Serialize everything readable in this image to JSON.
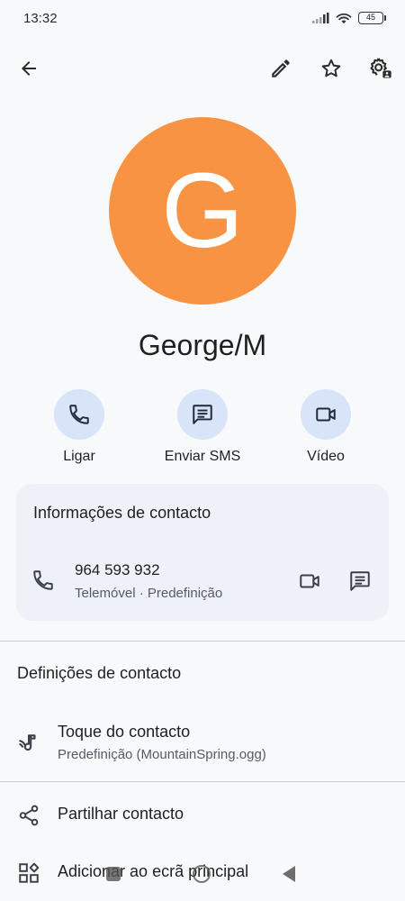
{
  "status_bar": {
    "time": "13:32",
    "battery": "45",
    "icons": [
      "signal-icon",
      "wifi-icon",
      "battery-icon"
    ]
  },
  "top_bar": {
    "icons": [
      "back-arrow-icon",
      "edit-pencil-icon",
      "star-outline-icon",
      "settings-gear-icon"
    ]
  },
  "contact": {
    "avatar_letter": "G",
    "avatar_color": "#f89343",
    "name": "George/M"
  },
  "actions": [
    {
      "label": "Ligar",
      "icon": "phone-icon"
    },
    {
      "label": "Enviar SMS",
      "icon": "message-icon"
    },
    {
      "label": "Vídeo",
      "icon": "video-camera-icon"
    }
  ],
  "info_card": {
    "title": "Informações de contacto",
    "phone_number": "964 593 932",
    "phone_sub": "Telemóvel · Predefinição"
  },
  "settings": {
    "title": "Definições de contacto",
    "ringtone_title": "Toque do contacto",
    "ringtone_sub": "Predefinição (MountainSpring.ogg)",
    "share_label": "Partilhar contacto",
    "add_home_label": "Adicionar ao ecrã principal"
  },
  "colors": {
    "accent_circle": "#d8e4f7",
    "card_bg": "#eef1f7",
    "background": "#f8f9fb"
  }
}
